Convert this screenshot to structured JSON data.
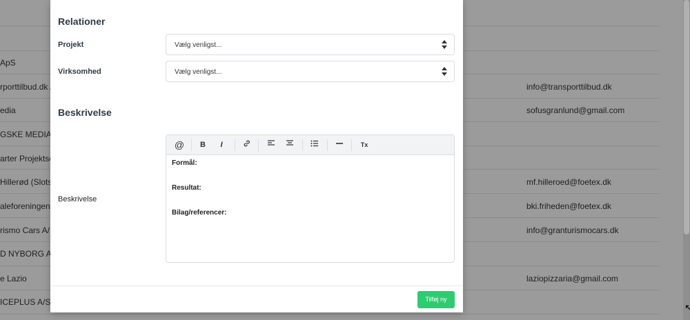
{
  "background_table": {
    "rows": [
      {
        "c1": "",
        "c2": ""
      },
      {
        "c1": "",
        "c2": ""
      },
      {
        "c1": "ApS",
        "c2": ""
      },
      {
        "c1": "rporttilbud.dk Ap",
        "c2": "info@transporttilbud.dk"
      },
      {
        "c1": "edia",
        "c2": "sofusgranlund@gmail.com"
      },
      {
        "c1": "GSKE MEDIA A",
        "c2": ""
      },
      {
        "c1": "arter Projektse",
        "c2": ""
      },
      {
        "c1": "Hillerød (Slotsra",
        "c2": "mf.hilleroed@foetex.dk"
      },
      {
        "c1": "aleforeningen I",
        "c2": "bki.friheden@foetex.dk"
      },
      {
        "c1": "rismo Cars A/S",
        "c2": "info@granturismocars.dk"
      },
      {
        "c1": "D NYBORG A/S",
        "c2": ""
      },
      {
        "c1": "e Lazio",
        "c2": "laziopizzaria@gmail.com"
      },
      {
        "c1": "ICEPLUS A/S",
        "c2": ""
      }
    ]
  },
  "modal": {
    "relations_title": "Relationer",
    "project_label": "Projekt",
    "project_value": "Vælg venligst...",
    "company_label": "Virksomhed",
    "company_value": "Vælg venligst...",
    "description_title": "Beskrivelse",
    "description_label": "Beskrivelse",
    "toolbar": {
      "mention": "@",
      "bold": "B",
      "italic": "I",
      "link": "🔗",
      "clear": "Tx"
    },
    "editor_lines": [
      "Formål:",
      "Resultat:",
      "Bilag/referencer:"
    ],
    "submit_label": "Tilføj ny"
  },
  "icons": {
    "select_arrows": "sort-arrows-icon",
    "align_left": "align-left-icon",
    "align_center": "align-center-icon",
    "bullet_list": "bullet-list-icon",
    "horizontal_rule": "horizontal-rule-icon"
  },
  "colors": {
    "primary_button": "#2ecc71",
    "heading": "#2f3b48",
    "overlay": "#9b9b9b"
  }
}
